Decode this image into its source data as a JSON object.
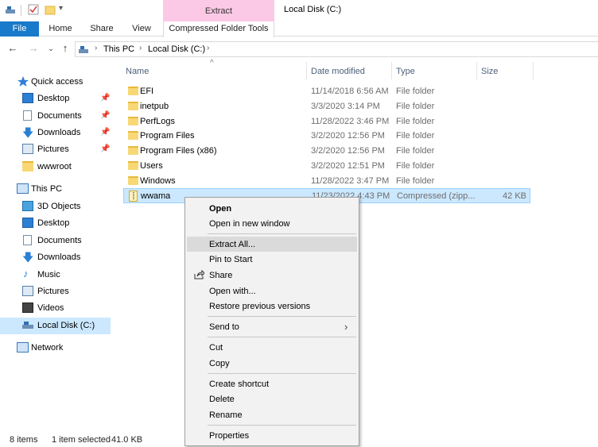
{
  "window": {
    "title": "Local Disk (C:)",
    "context_tab": "Extract",
    "context_color": "#fbc9e6",
    "accent": "#1979ca"
  },
  "ribbon": {
    "tabs": [
      "File",
      "Home",
      "Share",
      "View",
      "Compressed Folder Tools"
    ]
  },
  "address": {
    "crumbs": [
      "This PC",
      "Local Disk (C:)"
    ]
  },
  "nav": {
    "quick_access": "Quick access",
    "quick_items": [
      "Desktop",
      "Documents",
      "Downloads",
      "Pictures",
      "wwwroot"
    ],
    "this_pc": "This PC",
    "pc_items": [
      "3D Objects",
      "Desktop",
      "Documents",
      "Downloads",
      "Music",
      "Pictures",
      "Videos",
      "Local Disk (C:)"
    ],
    "network": "Network"
  },
  "columns": {
    "name": "Name",
    "date": "Date modified",
    "type": "Type",
    "size": "Size"
  },
  "files": [
    {
      "name": "EFI",
      "date": "11/14/2018 6:56 AM",
      "type": "File folder",
      "size": ""
    },
    {
      "name": "inetpub",
      "date": "3/3/2020 3:14 PM",
      "type": "File folder",
      "size": ""
    },
    {
      "name": "PerfLogs",
      "date": "11/28/2022 3:46 PM",
      "type": "File folder",
      "size": ""
    },
    {
      "name": "Program Files",
      "date": "3/2/2020 12:56 PM",
      "type": "File folder",
      "size": ""
    },
    {
      "name": "Program Files (x86)",
      "date": "3/2/2020 12:56 PM",
      "type": "File folder",
      "size": ""
    },
    {
      "name": "Users",
      "date": "3/2/2020 12:51 PM",
      "type": "File folder",
      "size": ""
    },
    {
      "name": "Windows",
      "date": "11/28/2022 3:47 PM",
      "type": "File folder",
      "size": ""
    },
    {
      "name": "wwama",
      "date": "11/23/2022 4:43 PM",
      "type": "Compressed (zipp...",
      "size": "42 KB"
    }
  ],
  "status": {
    "items": "8 items",
    "selected": "1 item selected",
    "size": "41.0 KB"
  },
  "context_menu": {
    "open": "Open",
    "open_new_window": "Open in new window",
    "extract_all": "Extract All...",
    "pin_to_start": "Pin to Start",
    "share": "Share",
    "open_with": "Open with...",
    "restore_previous": "Restore previous versions",
    "send_to": "Send to",
    "cut": "Cut",
    "copy": "Copy",
    "create_shortcut": "Create shortcut",
    "delete": "Delete",
    "rename": "Rename",
    "properties": "Properties"
  }
}
